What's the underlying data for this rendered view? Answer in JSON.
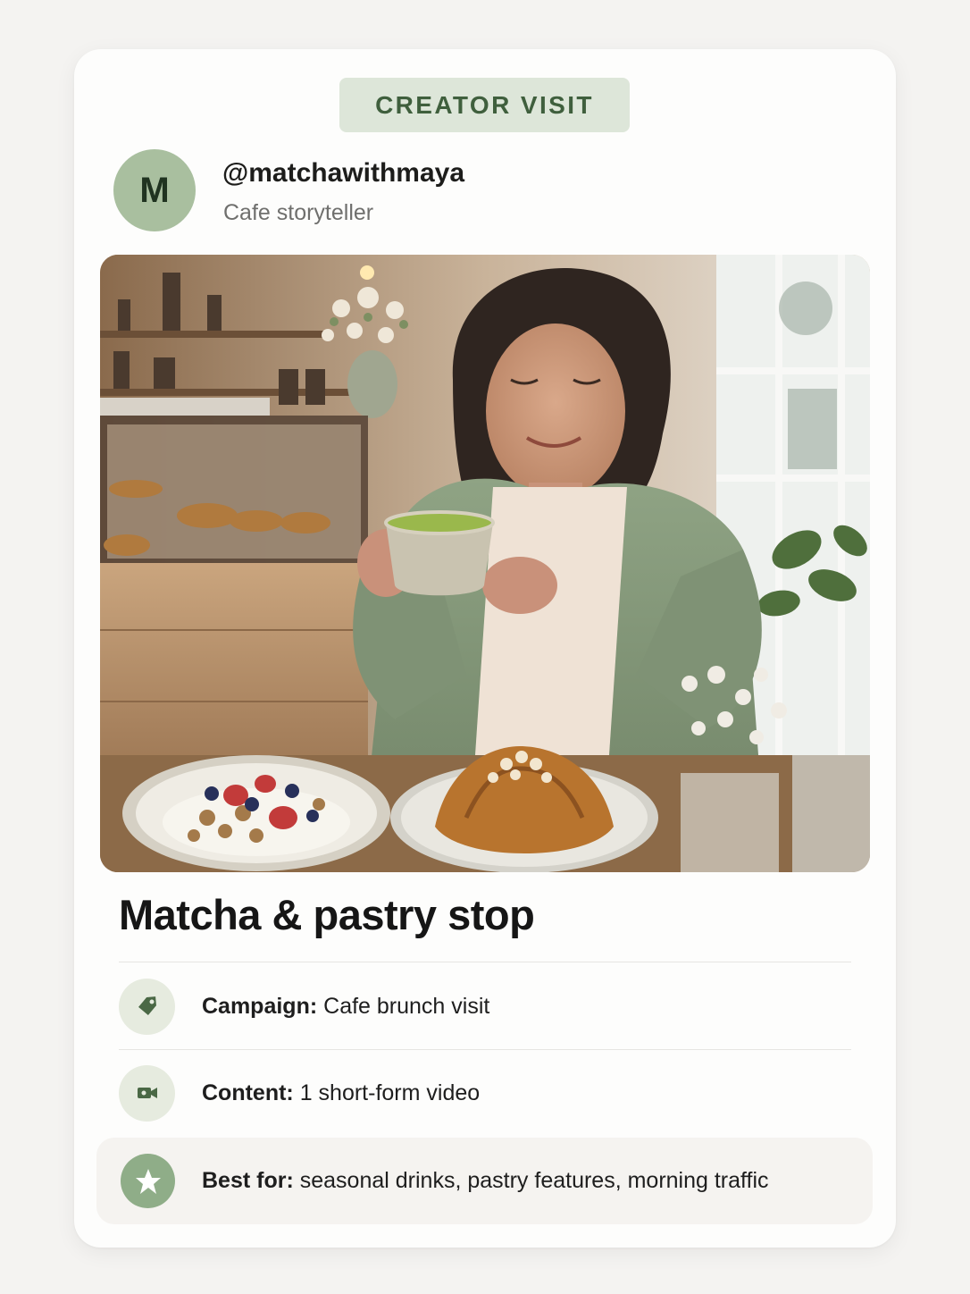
{
  "card": {
    "badge": "CREATOR VISIT",
    "avatar_initial": "M",
    "handle": "@matchawithmaya",
    "role": "Cafe storyteller",
    "photo_icon": "cafe-photo",
    "title": "Matcha & pastry stop",
    "details": [
      {
        "icon": "tag-icon",
        "label": "Campaign:",
        "value": "Cafe brunch visit"
      },
      {
        "icon": "video-camera-icon",
        "label": "Content:",
        "value": "1 short-form video"
      },
      {
        "icon": "star-icon",
        "label": "Best for:",
        "value": "seasonal drinks, pastry features, morning traffic"
      }
    ]
  },
  "colors": {
    "accent": "#8fad88",
    "badge_bg": "#dde6d9",
    "badge_text": "#3f5f3d"
  }
}
